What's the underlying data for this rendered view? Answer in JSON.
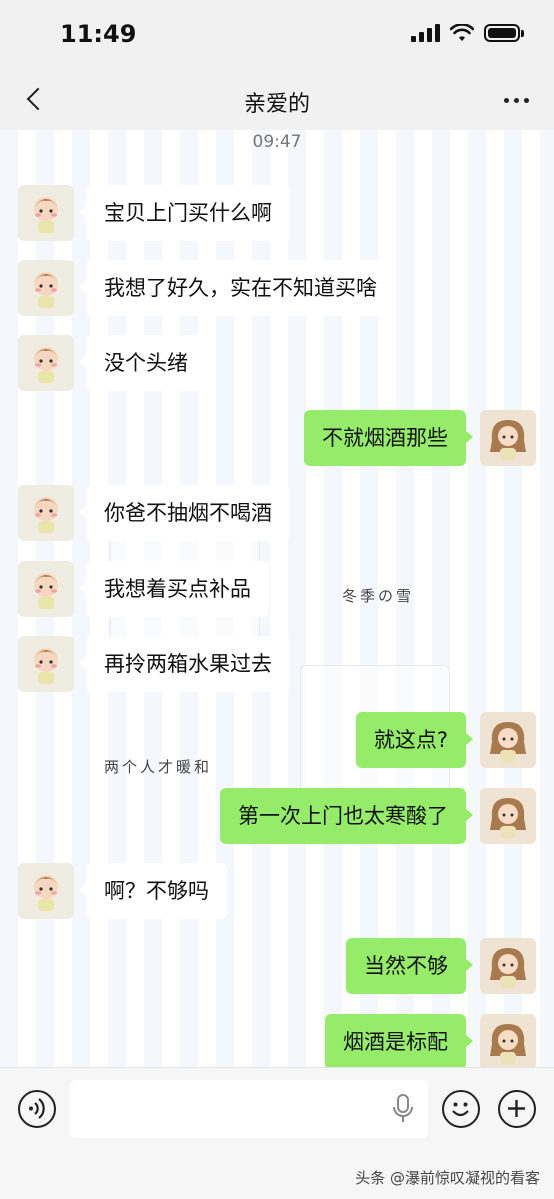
{
  "status_bar": {
    "time": "11:49"
  },
  "header": {
    "title": "亲爱的"
  },
  "chat": {
    "timestamp": "09:47",
    "messages": [
      {
        "side": "in",
        "text": "宝贝上门买什么啊"
      },
      {
        "side": "in",
        "text": "我想了好久，实在不知道买啥"
      },
      {
        "side": "in",
        "text": "没个头绪"
      },
      {
        "side": "out",
        "text": "不就烟酒那些"
      },
      {
        "side": "in",
        "text": "你爸不抽烟不喝酒"
      },
      {
        "side": "in",
        "text": "我想着买点补品"
      },
      {
        "side": "in",
        "text": "再拎两箱水果过去"
      },
      {
        "side": "out",
        "text": "就这点?"
      },
      {
        "side": "out",
        "text": "第一次上门也太寒酸了"
      },
      {
        "side": "in",
        "text": "啊？不够吗"
      },
      {
        "side": "out",
        "text": "当然不够"
      },
      {
        "side": "out",
        "text": "烟酒是标配"
      }
    ]
  },
  "background": {
    "deco_text_1": "冬季の雪",
    "deco_text_2": "两个人才暖和"
  },
  "footer": {
    "watermark": "头条 @瀑前惊叹凝视的看客"
  },
  "colors": {
    "outgoing_bubble": "#95ec69",
    "incoming_bubble": "#ffffff",
    "bar": "#f1f1f1"
  },
  "icons": [
    "back-icon",
    "more-icon",
    "voice-icon",
    "mic-icon",
    "emoji-icon",
    "plus-icon"
  ]
}
